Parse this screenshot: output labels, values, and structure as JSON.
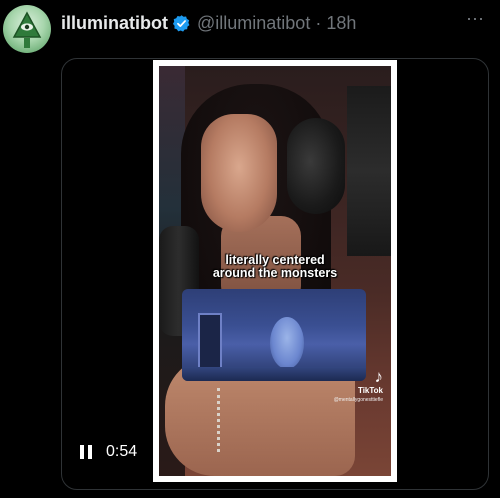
{
  "author": {
    "display_name": "illuminatibot",
    "handle": "@illuminatibot",
    "separator": "·",
    "time": "18h",
    "verified": true,
    "avatar_icon": "illuminati-eye-pyramid-icon",
    "verified_icon": "verified-badge-icon"
  },
  "more_icon": "⋯",
  "video": {
    "caption_line1": "literally centered",
    "caption_line2": "around the monsters",
    "watermark_logo": "♪",
    "watermark_brand": "TikTok",
    "watermark_user": "@mentallygonesttiefle",
    "elapsed": "0:54",
    "state": "playing"
  },
  "colors": {
    "background": "#000000",
    "text_primary": "#e7e9ea",
    "text_secondary": "#71767b",
    "verified_blue": "#1d9bf0",
    "border": "#2f3336"
  }
}
